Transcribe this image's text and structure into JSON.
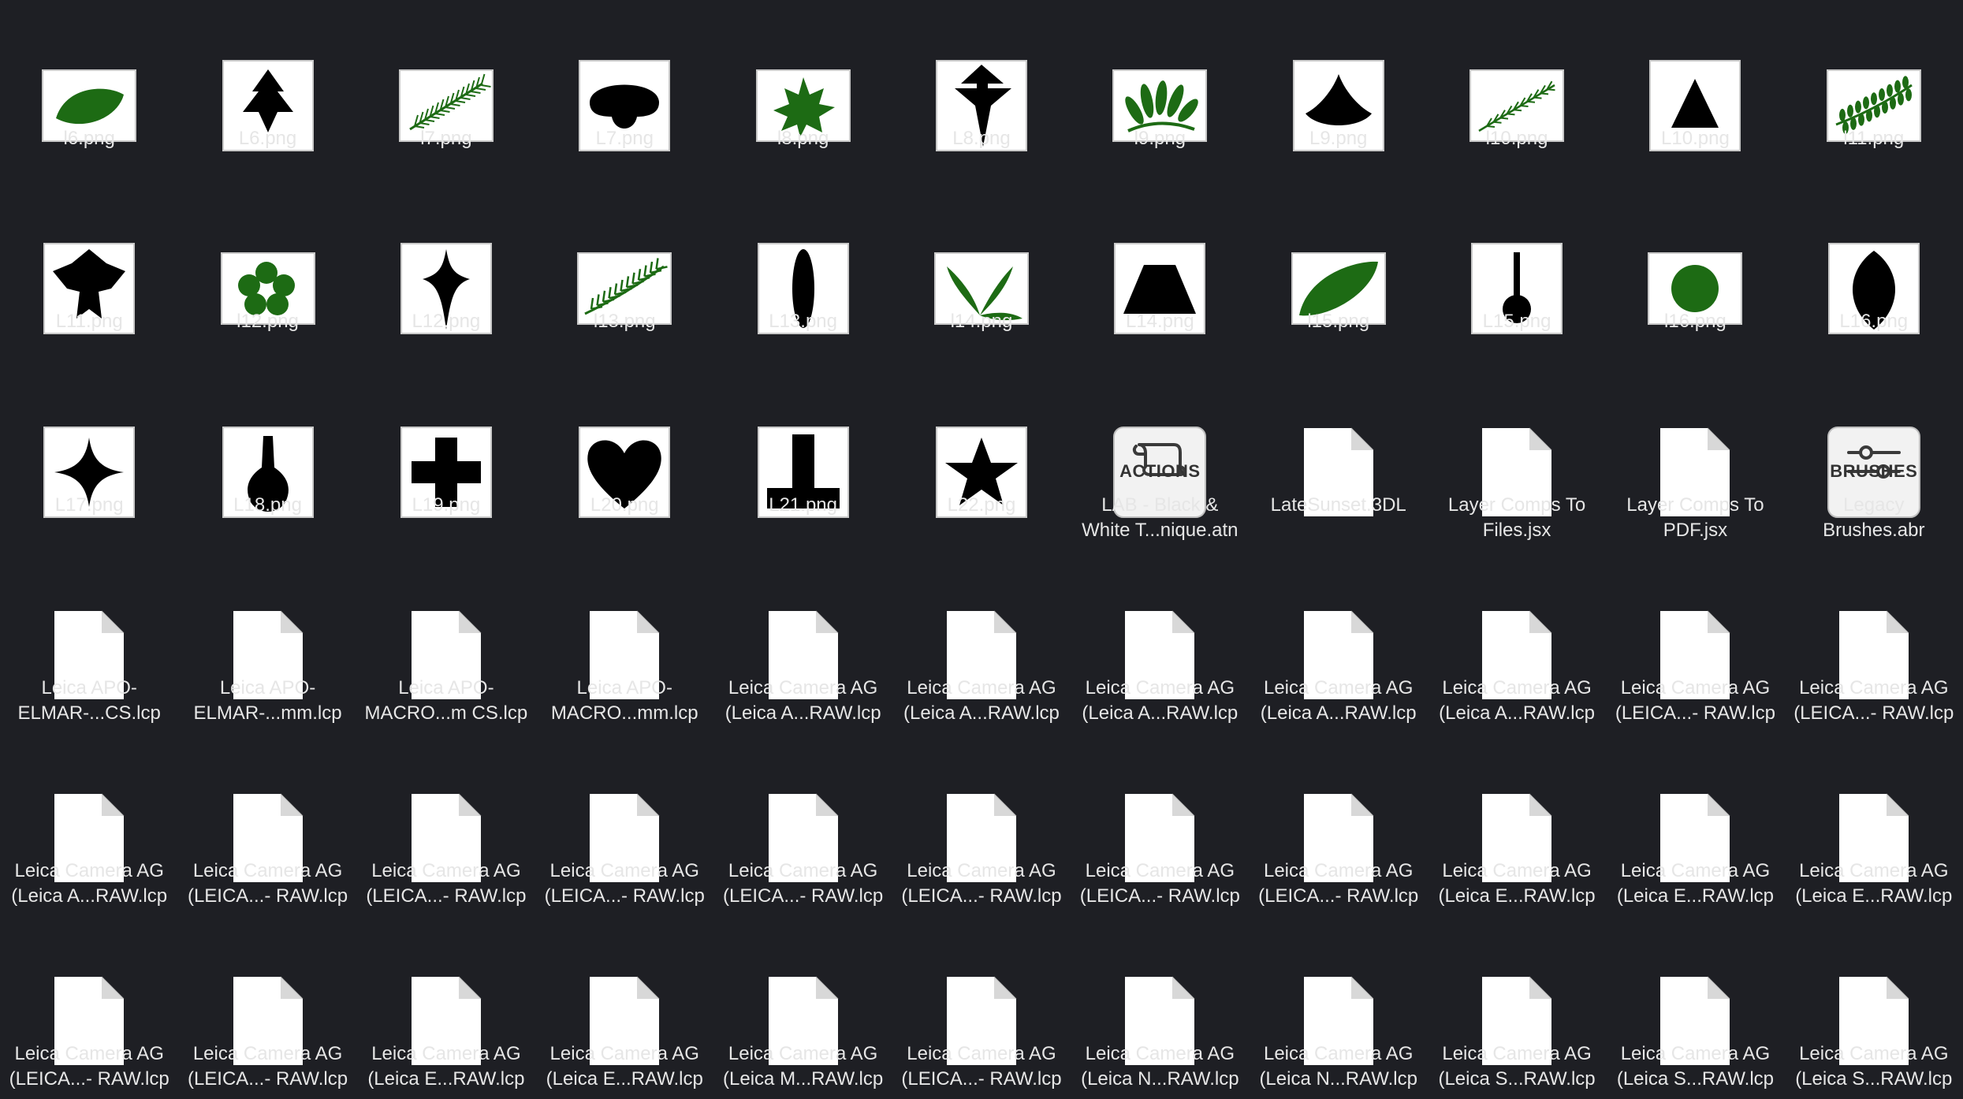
{
  "window": {
    "view": "icon-grid"
  },
  "colors": {
    "background": "#1e1f24",
    "label": "#e6e6e6",
    "leaf_green": "#1d6b14"
  },
  "files": [
    {
      "name": "l6.png",
      "lines": [
        "l6.png"
      ],
      "icon": "green-leaf-icon",
      "kind": "image"
    },
    {
      "name": "L6.png",
      "lines": [
        "L6.png"
      ],
      "icon": "black-leaf-arrow-icon",
      "kind": "image"
    },
    {
      "name": "l7.png",
      "lines": [
        "l7.png"
      ],
      "icon": "fern-sprig-icon",
      "kind": "image"
    },
    {
      "name": "L7.png",
      "lines": [
        "L7.png"
      ],
      "icon": "black-cloud-shape-icon",
      "kind": "image"
    },
    {
      "name": "l8.png",
      "lines": [
        "l8.png"
      ],
      "icon": "maple-leaf-icon",
      "kind": "image"
    },
    {
      "name": "L8.png",
      "lines": [
        "L8.png"
      ],
      "icon": "black-arrow-leaf-icon",
      "kind": "image"
    },
    {
      "name": "l9.png",
      "lines": [
        "l9.png"
      ],
      "icon": "leaf-cluster-icon",
      "kind": "image"
    },
    {
      "name": "L9.png",
      "lines": [
        "L9.png"
      ],
      "icon": "black-fan-shape-icon",
      "kind": "image"
    },
    {
      "name": "l10.png",
      "lines": [
        "l10.png"
      ],
      "icon": "twig-sprig-icon",
      "kind": "image"
    },
    {
      "name": "L10.png",
      "lines": [
        "L10.png"
      ],
      "icon": "black-triangle-icon",
      "kind": "image"
    },
    {
      "name": "l11.png",
      "lines": [
        "l11.png"
      ],
      "icon": "leafy-branch-icon",
      "kind": "image"
    },
    {
      "name": "L11.png",
      "lines": [
        "L11.png"
      ],
      "icon": "black-lobed-leaf-icon",
      "kind": "image"
    },
    {
      "name": "l12.png",
      "lines": [
        "l12.png"
      ],
      "icon": "clover-leaf-icon",
      "kind": "image"
    },
    {
      "name": "L12.png",
      "lines": [
        "L12.png"
      ],
      "icon": "black-four-point-star-icon",
      "kind": "image"
    },
    {
      "name": "l13.png",
      "lines": [
        "l13.png"
      ],
      "icon": "rosemary-sprig-icon",
      "kind": "image"
    },
    {
      "name": "L13.png",
      "lines": [
        "L13.png"
      ],
      "icon": "black-ellipse-icon",
      "kind": "image"
    },
    {
      "name": "l14.png",
      "lines": [
        "l14.png"
      ],
      "icon": "bamboo-leaves-icon",
      "kind": "image"
    },
    {
      "name": "L14.png",
      "lines": [
        "L14.png"
      ],
      "icon": "black-trapezoid-icon",
      "kind": "image"
    },
    {
      "name": "l15.png",
      "lines": [
        "l15.png"
      ],
      "icon": "green-oval-leaf-icon",
      "kind": "image"
    },
    {
      "name": "L15.png",
      "lines": [
        "L15.png"
      ],
      "icon": "black-lollipop-icon",
      "kind": "image"
    },
    {
      "name": "l16.png",
      "lines": [
        "l16.png"
      ],
      "icon": "green-circle-icon",
      "kind": "image"
    },
    {
      "name": "L16.png",
      "lines": [
        "L16.png"
      ],
      "icon": "black-pointed-oval-icon",
      "kind": "image"
    },
    {
      "name": "L17.png",
      "lines": [
        "L17.png"
      ],
      "icon": "black-sparkle-star-icon",
      "kind": "image"
    },
    {
      "name": "L18.png",
      "lines": [
        "L18.png"
      ],
      "icon": "black-bulb-shape-icon",
      "kind": "image"
    },
    {
      "name": "L19.png",
      "lines": [
        "L19.png"
      ],
      "icon": "black-cross-icon",
      "kind": "image"
    },
    {
      "name": "L20.png",
      "lines": [
        "L20.png"
      ],
      "icon": "black-heart-icon",
      "kind": "image"
    },
    {
      "name": "L21.png",
      "lines": [
        "L21.png"
      ],
      "icon": "black-t-shape-icon",
      "kind": "image"
    },
    {
      "name": "L22.png",
      "lines": [
        "L22.png"
      ],
      "icon": "black-star-icon",
      "kind": "image"
    },
    {
      "name": "LAB - Black & White T...nique.atn",
      "lines": [
        "LAB - Black &",
        "White T...nique.atn"
      ],
      "icon": "actions-scroll-icon",
      "kind": "actions",
      "badge": "ACTIONS"
    },
    {
      "name": "LateSunset.3DL",
      "lines": [
        "LateSunset.3DL"
      ],
      "icon": "document-icon",
      "kind": "doc"
    },
    {
      "name": "Layer Comps To Files.jsx",
      "lines": [
        "Layer Comps To",
        "Files.jsx"
      ],
      "icon": "document-icon",
      "kind": "doc"
    },
    {
      "name": "Layer Comps To PDF.jsx",
      "lines": [
        "Layer Comps To",
        "PDF.jsx"
      ],
      "icon": "document-icon",
      "kind": "doc"
    },
    {
      "name": "Legacy Brushes.abr",
      "lines": [
        "Legacy",
        "Brushes.abr"
      ],
      "icon": "brushes-sliders-icon",
      "kind": "brushes",
      "badge": "BRUSHES"
    },
    {
      "name": "Leica APO-ELMAR-...CS.lcp",
      "lines": [
        "Leica APO-",
        "ELMAR-...CS.lcp"
      ],
      "icon": "document-icon",
      "kind": "doc"
    },
    {
      "name": "Leica APO-ELMAR-...mm.lcp",
      "lines": [
        "Leica APO-",
        "ELMAR-...mm.lcp"
      ],
      "icon": "document-icon",
      "kind": "doc"
    },
    {
      "name": "Leica APO-MACRO...m CS.lcp",
      "lines": [
        "Leica APO-",
        "MACRO...m CS.lcp"
      ],
      "icon": "document-icon",
      "kind": "doc"
    },
    {
      "name": "Leica APO-MACRO...mm.lcp",
      "lines": [
        "Leica APO-",
        "MACRO...mm.lcp"
      ],
      "icon": "document-icon",
      "kind": "doc"
    },
    {
      "name": "Leica Camera AG (Leica A...RAW.lcp",
      "lines": [
        "Leica Camera AG",
        "(Leica A...RAW.lcp"
      ],
      "icon": "document-icon",
      "kind": "doc"
    },
    {
      "name": "Leica Camera AG (Leica A...RAW.lcp",
      "lines": [
        "Leica Camera AG",
        "(Leica A...RAW.lcp"
      ],
      "icon": "document-icon",
      "kind": "doc"
    },
    {
      "name": "Leica Camera AG (Leica A...RAW.lcp",
      "lines": [
        "Leica Camera AG",
        "(Leica A...RAW.lcp"
      ],
      "icon": "document-icon",
      "kind": "doc"
    },
    {
      "name": "Leica Camera AG (Leica A...RAW.lcp",
      "lines": [
        "Leica Camera AG",
        "(Leica A...RAW.lcp"
      ],
      "icon": "document-icon",
      "kind": "doc"
    },
    {
      "name": "Leica Camera AG (Leica A...RAW.lcp",
      "lines": [
        "Leica Camera AG",
        "(Leica A...RAW.lcp"
      ],
      "icon": "document-icon",
      "kind": "doc"
    },
    {
      "name": "Leica Camera AG (LEICA...- RAW.lcp",
      "lines": [
        "Leica Camera AG",
        "(LEICA...- RAW.lcp"
      ],
      "icon": "document-icon",
      "kind": "doc"
    },
    {
      "name": "Leica Camera AG (LEICA...- RAW.lcp",
      "lines": [
        "Leica Camera AG",
        "(LEICA...- RAW.lcp"
      ],
      "icon": "document-icon",
      "kind": "doc"
    },
    {
      "name": "Leica Camera AG (Leica A...RAW.lcp",
      "lines": [
        "Leica Camera AG",
        "(Leica A...RAW.lcp"
      ],
      "icon": "document-icon",
      "kind": "doc"
    },
    {
      "name": "Leica Camera AG (LEICA...- RAW.lcp",
      "lines": [
        "Leica Camera AG",
        "(LEICA...- RAW.lcp"
      ],
      "icon": "document-icon",
      "kind": "doc"
    },
    {
      "name": "Leica Camera AG (LEICA...- RAW.lcp",
      "lines": [
        "Leica Camera AG",
        "(LEICA...- RAW.lcp"
      ],
      "icon": "document-icon",
      "kind": "doc"
    },
    {
      "name": "Leica Camera AG (LEICA...- RAW.lcp",
      "lines": [
        "Leica Camera AG",
        "(LEICA...- RAW.lcp"
      ],
      "icon": "document-icon",
      "kind": "doc"
    },
    {
      "name": "Leica Camera AG (LEICA...- RAW.lcp",
      "lines": [
        "Leica Camera AG",
        "(LEICA...- RAW.lcp"
      ],
      "icon": "document-icon",
      "kind": "doc"
    },
    {
      "name": "Leica Camera AG (LEICA...- RAW.lcp",
      "lines": [
        "Leica Camera AG",
        "(LEICA...- RAW.lcp"
      ],
      "icon": "document-icon",
      "kind": "doc"
    },
    {
      "name": "Leica Camera AG (LEICA...- RAW.lcp",
      "lines": [
        "Leica Camera AG",
        "(LEICA...- RAW.lcp"
      ],
      "icon": "document-icon",
      "kind": "doc"
    },
    {
      "name": "Leica Camera AG (LEICA...- RAW.lcp",
      "lines": [
        "Leica Camera AG",
        "(LEICA...- RAW.lcp"
      ],
      "icon": "document-icon",
      "kind": "doc"
    },
    {
      "name": "Leica Camera AG (Leica E...RAW.lcp",
      "lines": [
        "Leica Camera AG",
        "(Leica E...RAW.lcp"
      ],
      "icon": "document-icon",
      "kind": "doc"
    },
    {
      "name": "Leica Camera AG (Leica E...RAW.lcp",
      "lines": [
        "Leica Camera AG",
        "(Leica E...RAW.lcp"
      ],
      "icon": "document-icon",
      "kind": "doc"
    },
    {
      "name": "Leica Camera AG (Leica E...RAW.lcp",
      "lines": [
        "Leica Camera AG",
        "(Leica E...RAW.lcp"
      ],
      "icon": "document-icon",
      "kind": "doc"
    },
    {
      "name": "Leica Camera AG (LEICA...- RAW.lcp",
      "lines": [
        "Leica Camera AG",
        "(LEICA...- RAW.lcp"
      ],
      "icon": "document-icon",
      "kind": "doc"
    },
    {
      "name": "Leica Camera AG (LEICA...- RAW.lcp",
      "lines": [
        "Leica Camera AG",
        "(LEICA...- RAW.lcp"
      ],
      "icon": "document-icon",
      "kind": "doc"
    },
    {
      "name": "Leica Camera AG (Leica E...RAW.lcp",
      "lines": [
        "Leica Camera AG",
        "(Leica E...RAW.lcp"
      ],
      "icon": "document-icon",
      "kind": "doc"
    },
    {
      "name": "Leica Camera AG (Leica E...RAW.lcp",
      "lines": [
        "Leica Camera AG",
        "(Leica E...RAW.lcp"
      ],
      "icon": "document-icon",
      "kind": "doc"
    },
    {
      "name": "Leica Camera AG (Leica M...RAW.lcp",
      "lines": [
        "Leica Camera AG",
        "(Leica M...RAW.lcp"
      ],
      "icon": "document-icon",
      "kind": "doc"
    },
    {
      "name": "Leica Camera AG (LEICA...- RAW.lcp",
      "lines": [
        "Leica Camera AG",
        "(LEICA...- RAW.lcp"
      ],
      "icon": "document-icon",
      "kind": "doc"
    },
    {
      "name": "Leica Camera AG (Leica N...RAW.lcp",
      "lines": [
        "Leica Camera AG",
        "(Leica N...RAW.lcp"
      ],
      "icon": "document-icon",
      "kind": "doc"
    },
    {
      "name": "Leica Camera AG (Leica N...RAW.lcp",
      "lines": [
        "Leica Camera AG",
        "(Leica N...RAW.lcp"
      ],
      "icon": "document-icon",
      "kind": "doc"
    },
    {
      "name": "Leica Camera AG (Leica S...RAW.lcp",
      "lines": [
        "Leica Camera AG",
        "(Leica S...RAW.lcp"
      ],
      "icon": "document-icon",
      "kind": "doc"
    },
    {
      "name": "Leica Camera AG (Leica S...RAW.lcp",
      "lines": [
        "Leica Camera AG",
        "(Leica S...RAW.lcp"
      ],
      "icon": "document-icon",
      "kind": "doc"
    },
    {
      "name": "Leica Camera AG (Leica S...RAW.lcp",
      "lines": [
        "Leica Camera AG",
        "(Leica S...RAW.lcp"
      ],
      "icon": "document-icon",
      "kind": "doc"
    }
  ]
}
